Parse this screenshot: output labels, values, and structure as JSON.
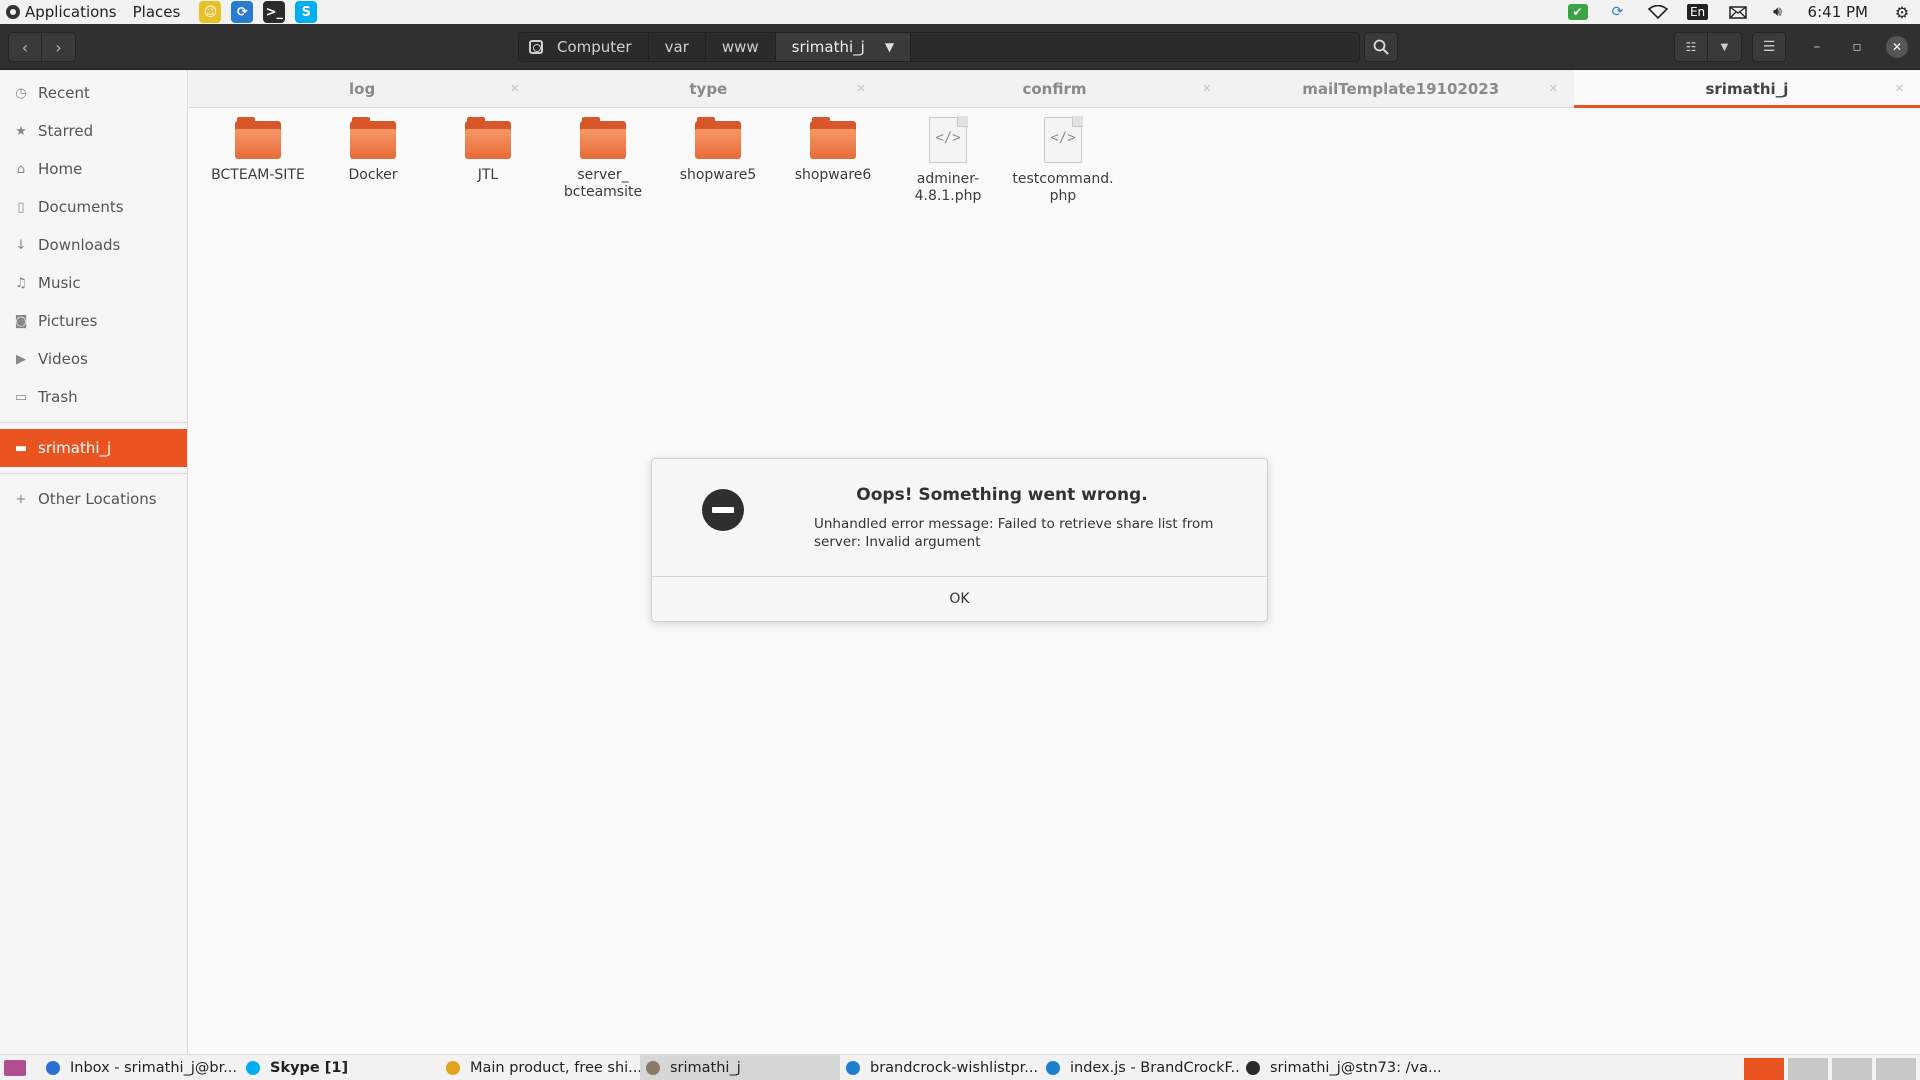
{
  "top_panel": {
    "applications": "Applications",
    "places": "Places",
    "launchers": [
      {
        "icon": "sun-face-icon",
        "color": "#e8c02a",
        "glyph": "☺"
      },
      {
        "icon": "sync-icon",
        "color": "#2a7ad0",
        "glyph": "⟳"
      },
      {
        "icon": "terminal-icon",
        "color": "#2b2b2b",
        "glyph": ">_"
      },
      {
        "icon": "skype-icon",
        "color": "#00aff0",
        "glyph": "S"
      }
    ],
    "language": "En",
    "clock": "6:41 PM"
  },
  "header": {
    "pathbar": [
      {
        "label": "Computer"
      },
      {
        "label": "var"
      },
      {
        "label": "www"
      },
      {
        "label": "srimathi_j"
      }
    ]
  },
  "sidebar": {
    "items": [
      {
        "label": "Recent",
        "icon": "clock-icon",
        "glyph": "◷"
      },
      {
        "label": "Starred",
        "icon": "star-icon",
        "glyph": "★"
      },
      {
        "label": "Home",
        "icon": "home-icon",
        "glyph": "⌂"
      },
      {
        "label": "Documents",
        "icon": "document-icon",
        "glyph": "▯"
      },
      {
        "label": "Downloads",
        "icon": "download-icon",
        "glyph": "↓"
      },
      {
        "label": "Music",
        "icon": "music-icon",
        "glyph": "♫"
      },
      {
        "label": "Pictures",
        "icon": "camera-icon",
        "glyph": "◙"
      },
      {
        "label": "Videos",
        "icon": "video-icon",
        "glyph": "▶"
      },
      {
        "label": "Trash",
        "icon": "trash-icon",
        "glyph": "▭"
      }
    ],
    "bookmark": {
      "label": "srimathi_j",
      "icon": "folder-icon",
      "glyph": "▬"
    },
    "other": {
      "label": "Other Locations",
      "icon": "plus-icon",
      "glyph": "+"
    }
  },
  "tabs": [
    {
      "label": "log",
      "active": false
    },
    {
      "label": "type",
      "active": false
    },
    {
      "label": "confirm",
      "active": false
    },
    {
      "label": "mailTemplate19102023",
      "active": false
    },
    {
      "label": "srimathi_j",
      "active": true
    }
  ],
  "files": [
    {
      "name": "BCTEAM-SITE",
      "kind": "folder"
    },
    {
      "name": "Docker",
      "kind": "folder"
    },
    {
      "name": "JTL",
      "kind": "folder"
    },
    {
      "name": "server_ bcteamsite",
      "kind": "folder"
    },
    {
      "name": "shopware5",
      "kind": "folder"
    },
    {
      "name": "shopware6",
      "kind": "folder"
    },
    {
      "name": "adminer-4.8.1.php",
      "kind": "code"
    },
    {
      "name": "testcommand.php",
      "kind": "code"
    }
  ],
  "dialog": {
    "title": "Oops! Something went wrong.",
    "message": "Unhandled error message: Failed to retrieve share list from server: Invalid argument",
    "ok": "OK"
  },
  "taskbar": {
    "tasks": [
      {
        "label": "Inbox - srimathi_j@br...",
        "icon": "thunderbird-icon",
        "color": "#2a6fd6",
        "active": false,
        "bold": false
      },
      {
        "label": "Skype [1]",
        "icon": "skype-icon",
        "color": "#00aff0",
        "active": false,
        "bold": true
      },
      {
        "label": "Main product, free shi...",
        "icon": "chrome-icon",
        "color": "#e3a21a",
        "active": false,
        "bold": false
      },
      {
        "label": "srimathi_j",
        "icon": "file-manager-icon",
        "color": "#8a7a6a",
        "active": true,
        "bold": false
      },
      {
        "label": "brandcrock-wishlistpr...",
        "icon": "vscode-icon",
        "color": "#1f7ed0",
        "active": false,
        "bold": false
      },
      {
        "label": "index.js - BrandCrockF...",
        "icon": "vscode-icon",
        "color": "#1f7ed0",
        "active": false,
        "bold": false
      },
      {
        "label": "srimathi_j@stn73: /va...",
        "icon": "terminal-icon",
        "color": "#2b2b2b",
        "active": false,
        "bold": false
      }
    ]
  },
  "colors": {
    "accent": "#e95420",
    "header": "#303030"
  }
}
